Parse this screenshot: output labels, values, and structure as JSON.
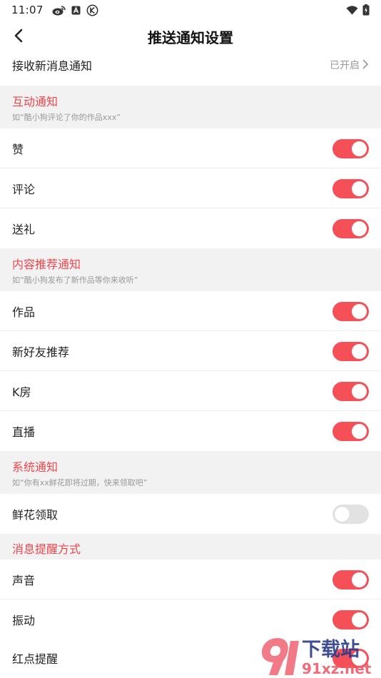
{
  "status_bar": {
    "time": "11:07",
    "icons_left": [
      "weibo-icon",
      "a-badge-icon",
      "k-circle-icon"
    ],
    "icons_right": [
      "wifi-icon",
      "battery-charging-icon"
    ]
  },
  "nav": {
    "title": "推送通知设置",
    "back_icon": "chevron-left-icon"
  },
  "top_row": {
    "label": "接收新消息通知",
    "value": "已开启",
    "icon": "chevron-right-icon"
  },
  "sections": [
    {
      "title": "互动通知",
      "subtitle": "如“酷小狗评论了你的作品xxx”",
      "items": [
        {
          "label": "赞",
          "on": true
        },
        {
          "label": "评论",
          "on": true
        },
        {
          "label": "送礼",
          "on": true
        }
      ]
    },
    {
      "title": "内容推荐通知",
      "subtitle": "如“酷小狗发布了新作品等你来收听”",
      "items": [
        {
          "label": "作品",
          "on": true
        },
        {
          "label": "新好友推荐",
          "on": true
        },
        {
          "label": "K房",
          "on": true
        },
        {
          "label": "直播",
          "on": true
        }
      ]
    },
    {
      "title": "系统通知",
      "subtitle": "如“你有xx鲜花即将过期，快来领取吧”",
      "items": [
        {
          "label": "鲜花领取",
          "on": false
        }
      ]
    },
    {
      "title": "消息提醒方式",
      "subtitle": "",
      "items": [
        {
          "label": "声音",
          "on": true
        },
        {
          "label": "振动",
          "on": true
        },
        {
          "label": "红点提醒",
          "on": true
        }
      ]
    }
  ],
  "watermark": {
    "top_text": "下载站",
    "bottom_text": "91xz.net"
  },
  "colors": {
    "accent": "#f0464c",
    "toggle_on": "#f55057",
    "toggle_off": "#e2e2e2",
    "section_bg": "#f2f2f2"
  }
}
